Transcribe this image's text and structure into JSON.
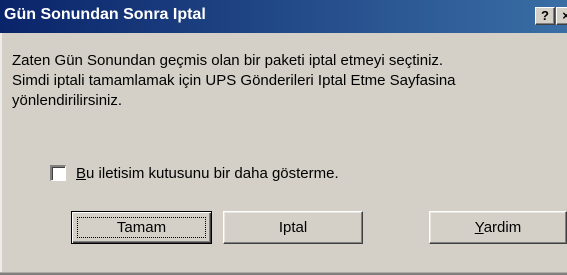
{
  "window": {
    "title": "Gün Sonundan Sonra Iptal",
    "help_button": "?",
    "close_button": "×"
  },
  "message": {
    "lines": [
      "Zaten Gün Sonundan geçmis olan bir paketi iptal etmeyi seçtiniz.",
      "Simdi iptali tamamlamak için UPS Gönderileri Iptal Etme Sayfasina",
      "yönlendirilirsiniz."
    ]
  },
  "checkbox": {
    "mnemonic": "B",
    "label_rest": "u iletisim kutusunu bir daha gösterme.",
    "checked": false
  },
  "buttons": {
    "ok_label": "Tamam",
    "cancel_label": "Iptal",
    "help_mnemonic": "Y",
    "help_label_rest": "ardim"
  },
  "colors": {
    "titlebar_start": "#0a246a",
    "titlebar_end": "#3a6ea5",
    "face": "#d4d0c8"
  }
}
